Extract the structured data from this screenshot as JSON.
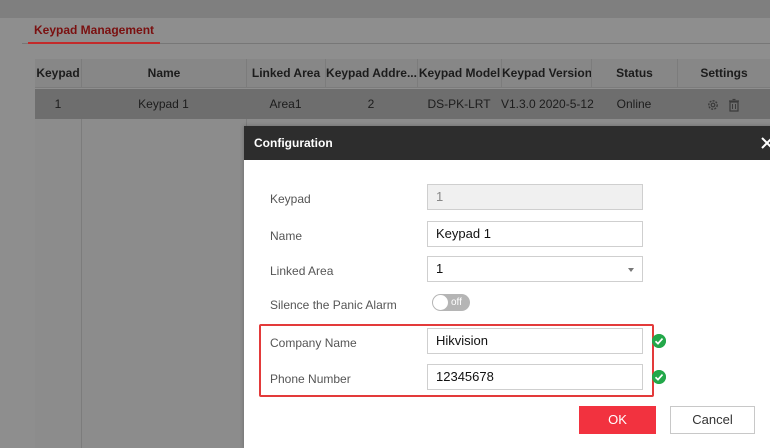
{
  "tab": {
    "label": "Keypad Management"
  },
  "table": {
    "columns": [
      "Keypad",
      "Name",
      "Linked Area",
      "Keypad Addre...",
      "Keypad Model",
      "Keypad Version",
      "Status",
      "Settings"
    ],
    "rows": [
      {
        "keypad": "1",
        "name": "Keypad 1",
        "linked_area": "Area1",
        "address": "2",
        "model": "DS-PK-LRT",
        "version": "V1.3.0 2020-5-12",
        "status": "Online",
        "settings_icons": [
          "gear-icon",
          "trash-icon"
        ]
      }
    ]
  },
  "dialog": {
    "title": "Configuration",
    "fields": {
      "keypad": {
        "label": "Keypad",
        "value": "1"
      },
      "name": {
        "label": "Name",
        "value": "Keypad 1"
      },
      "linked_area": {
        "label": "Linked Area",
        "value": "1"
      },
      "silence_panic": {
        "label": "Silence the Panic Alarm",
        "state": "off"
      },
      "company_name": {
        "label": "Company Name",
        "value": "Hikvision"
      },
      "phone_number": {
        "label": "Phone Number",
        "value": "12345678"
      }
    },
    "ok_label": "OK",
    "cancel_label": "Cancel"
  },
  "colors": {
    "accent": "#f2323f",
    "highlight": "#e33a3a",
    "valid": "#23a84a",
    "header": "#2d2d2d"
  }
}
